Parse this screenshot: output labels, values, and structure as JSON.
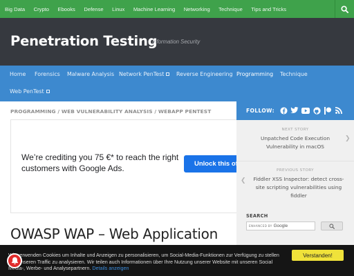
{
  "topnav": {
    "items": [
      "Big Data",
      "Crypto",
      "Ebooks",
      "Defense",
      "Linux",
      "Machine Learning",
      "Networking",
      "Technique",
      "Tips and Tricks"
    ],
    "search_icon": "search-icon"
  },
  "header": {
    "title": "Penetration Testing",
    "tagline": "Information Security"
  },
  "mainnav": {
    "items": [
      "Home",
      "Forensics",
      "Malware Analysis",
      "Network PenTest",
      "Reverse Engineering",
      "Programming",
      "Technique",
      "Web PenTest"
    ],
    "active": "Programming"
  },
  "breadcrumb": [
    "PROGRAMMING",
    "WEB VULNERABILITY ANALYSIS",
    "WEBAPP PENTEST"
  ],
  "breadcrumb_sep": "/",
  "ad": {
    "text": "We’re crediting you 75 €* to reach the right customers with Google Ads.",
    "button": "Unlock this of"
  },
  "post": {
    "title": "OWASP WAP – Web Application"
  },
  "sidebar": {
    "follow_label": "FOLLOW:",
    "social_icons": [
      "facebook-icon",
      "twitter-icon",
      "youtube-icon",
      "github-icon",
      "patreon-icon",
      "rss-icon"
    ],
    "next_label": "NEXT STORY",
    "next_title": "Unpatched Code Execution Vulnerability in macOS",
    "prev_label": "PREVIOUS STORY",
    "prev_title": "Fiddler XSS Inspector: detect cross-site scripting vulnerabilities using fiddler",
    "search_label": "SEARCH",
    "search_enhanced": "ENHANCED BY",
    "search_google": "Google"
  },
  "cookie": {
    "text": "Wir verwenden Cookies um Inhalte und Anzeigen zu personalisieren, um Social-Media-Funktionen zur Verfügung zu stellen und unseren Traffic zu analysieren. Wir teilen auch Informationen über Ihre Nutzung unserer Website mit unseren Social Media-, Werbe- und Analysepartnern.",
    "link": "Details anzeigen",
    "button": "Verstanden!"
  },
  "colors": {
    "topnav_bg": "#3fa24b",
    "header_bg": "#36393f",
    "mainnav_bg": "#3d89cf",
    "cookie_button": "#f0e23a"
  }
}
